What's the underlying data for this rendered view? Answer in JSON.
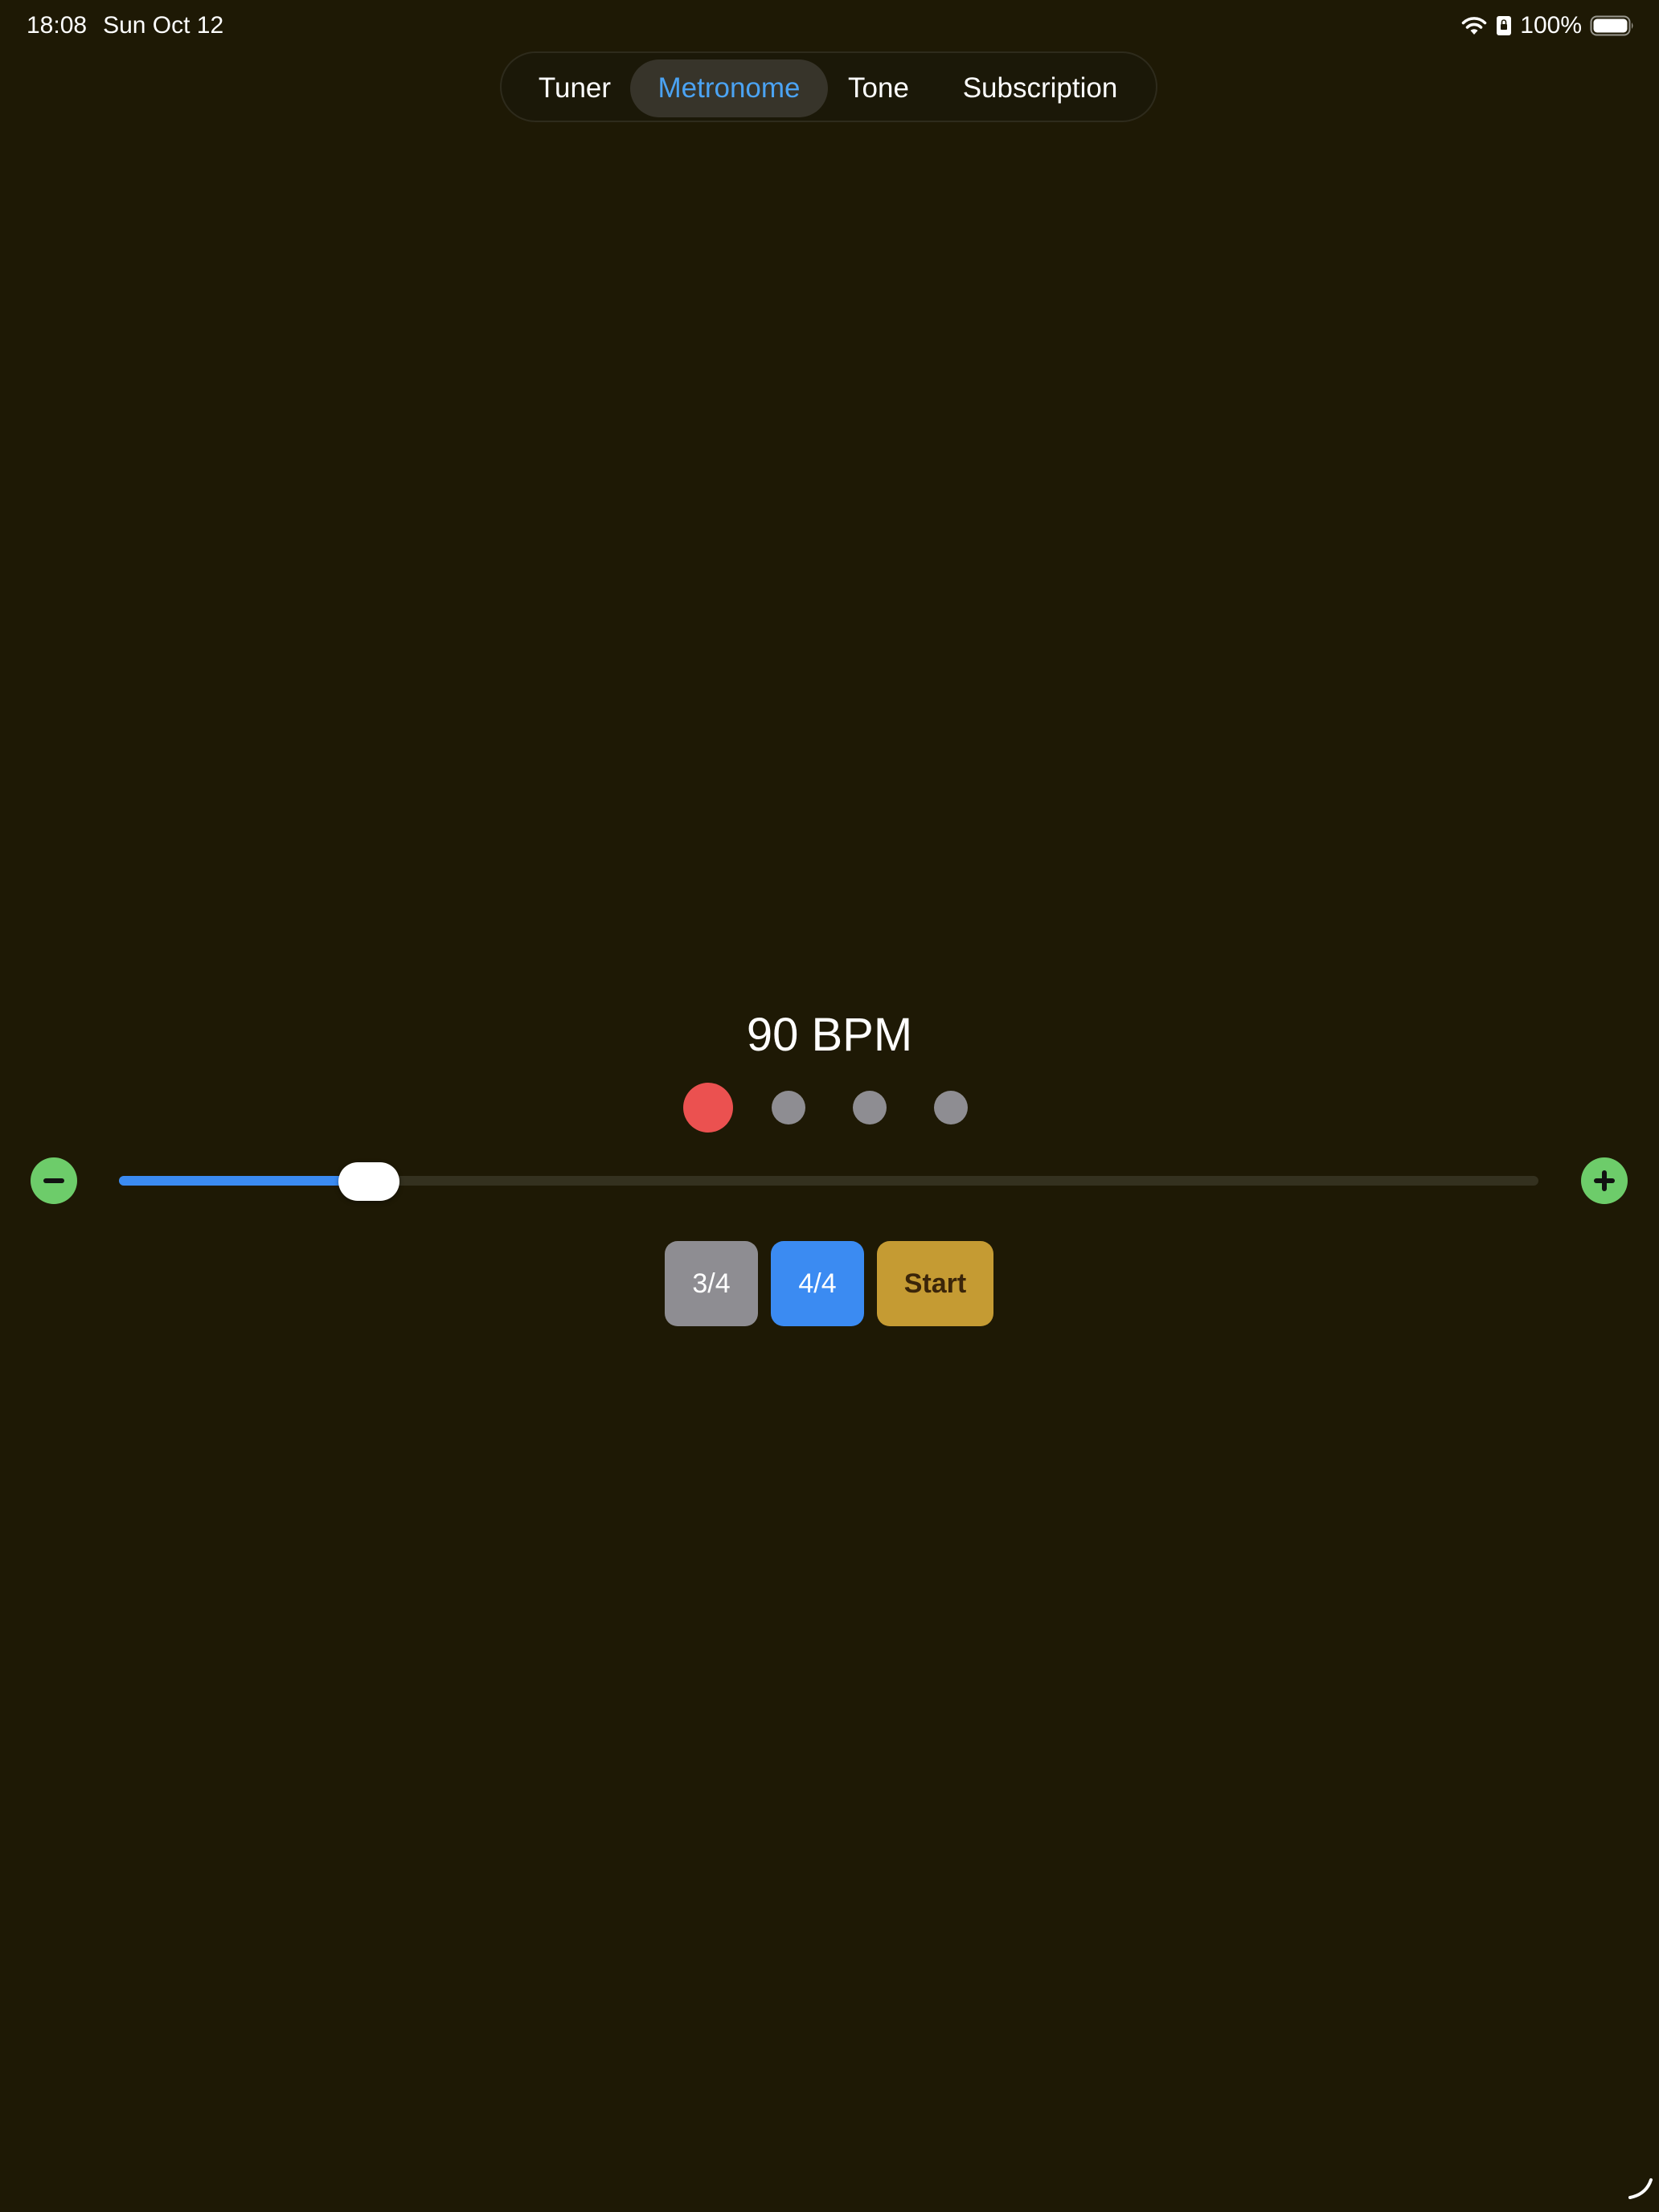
{
  "status_bar": {
    "time": "18:08",
    "date": "Sun Oct 12",
    "battery_percent": "100%",
    "icons": [
      "wifi-icon",
      "portrait-lock-icon",
      "battery-icon"
    ]
  },
  "tabs": [
    {
      "label": "Tuner",
      "active": false
    },
    {
      "label": "Metronome",
      "active": true
    },
    {
      "label": "Tone",
      "active": false
    },
    {
      "label": "Subscription",
      "active": false
    }
  ],
  "metronome": {
    "bpm_label": "90 BPM",
    "beats": [
      {
        "state": "accent",
        "color": "#eb5150"
      },
      {
        "state": "inactive",
        "color": "#8e8d92"
      },
      {
        "state": "inactive",
        "color": "#8e8d92"
      },
      {
        "state": "inactive",
        "color": "#8e8d92"
      }
    ],
    "tempo_slider": {
      "fraction": 0.176,
      "decrement_icon": "minus-icon",
      "increment_icon": "plus-icon"
    },
    "time_signatures": [
      {
        "label": "3/4",
        "selected": false
      },
      {
        "label": "4/4",
        "selected": true
      }
    ],
    "start_label": "Start"
  },
  "colors": {
    "background": "#1e1905",
    "accent_blue": "#3b8bf2",
    "tab_active_text": "#4ba3f3",
    "green_button": "#6dcc6a",
    "start_button": "#c59b33",
    "accent_beat": "#eb5150"
  }
}
